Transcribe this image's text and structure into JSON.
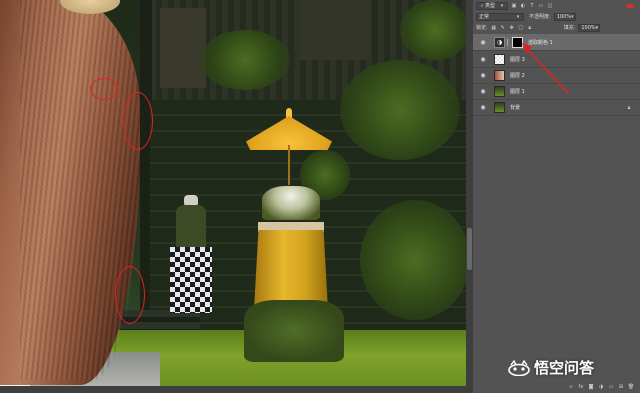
{
  "toolbar": {
    "filter_kind": "类型",
    "blend_mode": "正常",
    "opacity_label": "不透明度:",
    "opacity_value": "100%",
    "lock_label": "锁定:",
    "fill_label": "填充:",
    "fill_value": "100%"
  },
  "layers": [
    {
      "name": "选取颜色 1",
      "selected": true
    },
    {
      "name": "图层 3",
      "selected": false
    },
    {
      "name": "图层 2",
      "selected": false
    },
    {
      "name": "图层 1",
      "selected": false
    },
    {
      "name": "背景",
      "selected": false
    }
  ],
  "watermark": {
    "text": "悟空问答"
  },
  "colors": {
    "annotation": "#e32020",
    "panel_bg": "#535353",
    "selected_layer": "#6a6a6a"
  },
  "icons": [
    "filter-icon",
    "eye-icon",
    "lock-icon",
    "link-icon",
    "fx-icon",
    "mask-icon",
    "adjustment-icon",
    "folder-icon",
    "new-layer-icon",
    "trash-icon"
  ]
}
